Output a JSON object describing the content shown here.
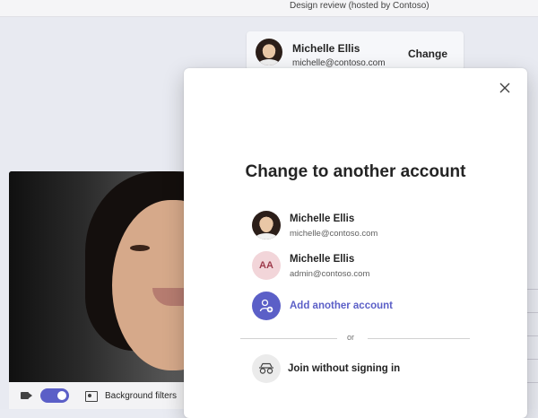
{
  "meeting": {
    "title": "Design review (hosted by Contoso)"
  },
  "current_account": {
    "name": "Michelle Ellis",
    "email": "michelle@contoso.com",
    "change_label": "Change"
  },
  "preview": {
    "camera_on": true,
    "background_filters_label": "Background filters"
  },
  "dialog": {
    "title": "Change to another account",
    "accounts": [
      {
        "name": "Michelle Ellis",
        "email": "michelle@contoso.com",
        "avatar": "photo"
      },
      {
        "name": "Michelle Ellis",
        "email": "admin@contoso.com",
        "avatar": "initials",
        "initials": "AA"
      }
    ],
    "add_account_label": "Add another account",
    "divider_label": "or",
    "guest_label": "Join without signing in"
  },
  "colors": {
    "accent": "#5b5fc7",
    "initials_bg": "#f2d5d9",
    "initials_fg": "#9e3b4c"
  },
  "icons": [
    "close-icon",
    "add-person-icon",
    "glasses-icon",
    "camera-icon",
    "background-filter-icon"
  ]
}
